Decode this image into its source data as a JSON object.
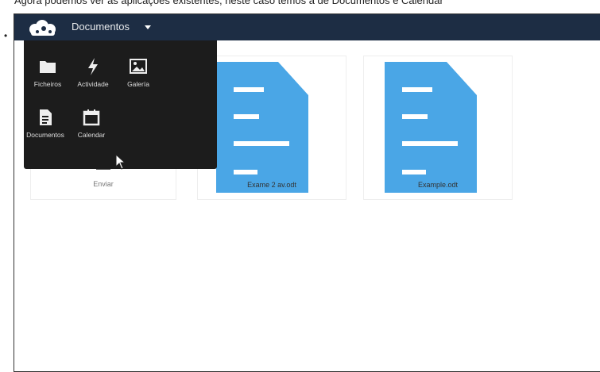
{
  "caption": "Agora podemos ver as aplicações existentes, neste caso temos a de Documentos e Calendar",
  "bullet": "•",
  "header": {
    "app_title": "Documentos",
    "logo_icon": "owncloud-cloud-logo-icon",
    "dropdown_icon": "caret-down-icon"
  },
  "menu": {
    "items": [
      {
        "label": "Ficheiros",
        "icon": "folder-icon"
      },
      {
        "label": "Actividade",
        "icon": "lightning-icon"
      },
      {
        "label": "Galería",
        "icon": "image-icon"
      },
      {
        "label": "Documentos",
        "icon": "document-icon"
      },
      {
        "label": "Calendar",
        "icon": "calendar-icon"
      }
    ]
  },
  "files": [
    {
      "name": "Enviar"
    },
    {
      "name": "Exame 2 av.odt"
    },
    {
      "name": "Example.odt"
    }
  ],
  "colors": {
    "topbar": "#1d2d44",
    "menu_bg": "#1c1c1c",
    "doc_blue": "#4aa6e6"
  }
}
